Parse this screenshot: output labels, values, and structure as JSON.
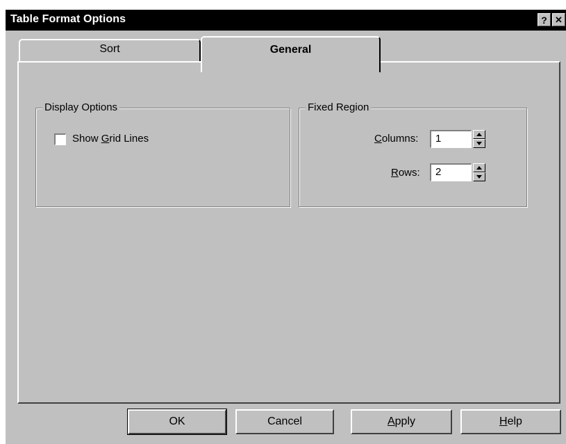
{
  "window": {
    "title": "Table Format Options",
    "help_glyph": "?",
    "close_glyph": "✕"
  },
  "tabs": [
    {
      "label": "Sort",
      "selected": false
    },
    {
      "label": "General",
      "selected": true
    }
  ],
  "display_options": {
    "legend": "Display Options",
    "show_grid_lines": {
      "label_pre": "Show ",
      "label_mnemonic": "G",
      "label_post": "rid Lines",
      "checked": false
    }
  },
  "fixed_region": {
    "legend": "Fixed Region",
    "columns": {
      "label_mnemonic": "C",
      "label_post": "olumns:",
      "value": "1"
    },
    "rows": {
      "label_mnemonic": "R",
      "label_post": "ows:",
      "value": "2"
    }
  },
  "buttons": {
    "ok": "OK",
    "cancel": "Cancel",
    "apply_mnemonic": "A",
    "apply_post": "pply",
    "help_mnemonic": "H",
    "help_post": "elp"
  },
  "colors": {
    "dialog_bg": "#c0c0c0",
    "titlebar_bg": "#000000",
    "titlebar_text": "#ffffff"
  },
  "icons": [
    "help-icon",
    "close-icon",
    "spin-up-icon",
    "spin-down-icon"
  ]
}
